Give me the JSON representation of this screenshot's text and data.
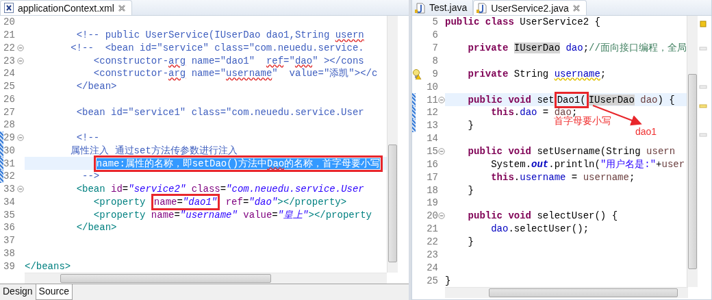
{
  "left_editor": {
    "tabs": [
      {
        "label": "applicationContext.xml",
        "selected": true,
        "closable": true
      }
    ],
    "lines": [
      {
        "number": "20",
        "fold": false,
        "current": false,
        "changed": false,
        "warning": false
      },
      {
        "number": "21",
        "fold": false,
        "current": false,
        "changed": false,
        "warning": false,
        "tokens": [
          {
            "text": "         <!-- public UserService(IUserDao dao1,String ",
            "kind": "c"
          },
          {
            "text": "usern",
            "kind": "cs"
          }
        ]
      },
      {
        "number": "22",
        "fold": true,
        "current": false,
        "changed": false,
        "warning": false,
        "tokens": [
          {
            "text": "        <!--  <bean id=\"service\" class=\"com.neuedu.service.",
            "kind": "c"
          }
        ]
      },
      {
        "number": "23",
        "fold": true,
        "current": false,
        "changed": false,
        "warning": false,
        "tokens": [
          {
            "text": "            <constructor-",
            "kind": "c"
          },
          {
            "text": "arg",
            "kind": "cs"
          },
          {
            "text": " name=\"dao1\"  ",
            "kind": "c"
          },
          {
            "text": "ref",
            "kind": "cs"
          },
          {
            "text": "=\"",
            "kind": "c"
          },
          {
            "text": "dao",
            "kind": "cs"
          },
          {
            "text": "\" ></cons",
            "kind": "c"
          }
        ]
      },
      {
        "number": "24",
        "fold": false,
        "current": false,
        "changed": false,
        "warning": false,
        "tokens": [
          {
            "text": "            <constructor-",
            "kind": "c"
          },
          {
            "text": "arg",
            "kind": "cs"
          },
          {
            "text": " name=\"",
            "kind": "c"
          },
          {
            "text": "username",
            "kind": "cs"
          },
          {
            "text": "\"  value=\"添凯\"></c",
            "kind": "c"
          }
        ]
      },
      {
        "number": "25",
        "fold": false,
        "current": false,
        "changed": false,
        "warning": false,
        "tokens": [
          {
            "text": "         </bean>",
            "kind": "c"
          }
        ]
      },
      {
        "number": "26",
        "fold": false,
        "current": false,
        "changed": false,
        "warning": false
      },
      {
        "number": "27",
        "fold": false,
        "current": false,
        "changed": false,
        "warning": false,
        "tokens": [
          {
            "text": "         <bean id=\"service1\" class=\"com.neuedu.service.User",
            "kind": "c"
          }
        ]
      },
      {
        "number": "28",
        "fold": false,
        "current": false,
        "changed": false,
        "warning": false
      },
      {
        "number": "29",
        "fold": true,
        "current": false,
        "changed": true,
        "warning": false,
        "tokens": [
          {
            "text": "         <!--",
            "kind": "c"
          }
        ]
      },
      {
        "number": "30",
        "fold": false,
        "current": false,
        "changed": true,
        "warning": false,
        "tokens": [
          {
            "text": "        属性注入 通过set方法传参数进行注入",
            "kind": "c"
          }
        ]
      },
      {
        "number": "31",
        "fold": false,
        "current": true,
        "changed": true,
        "warning": false,
        "tokens": [
          {
            "kind": "boxed",
            "tokens": [
              {
                "text": "            name:属性的名称，即setDao()方法中",
                "kind": "sel"
              },
              {
                "text": "Dao",
                "kind": "selspell"
              },
              {
                "text": "的名称，首字母要小写",
                "kind": "sel"
              }
            ]
          }
        ]
      },
      {
        "number": "32",
        "fold": false,
        "current": false,
        "changed": true,
        "warning": false,
        "tokens": [
          {
            "text": "          -->",
            "kind": "c"
          }
        ]
      },
      {
        "number": "33",
        "fold": true,
        "current": false,
        "changed": false,
        "warning": false,
        "tokens": [
          {
            "text": "         <bean ",
            "kind": "t"
          },
          {
            "text": "id",
            "kind": "a"
          },
          {
            "text": "=",
            "kind": "p"
          },
          {
            "text": "\"service2\"",
            "kind": "v"
          },
          {
            "text": " class",
            "kind": "a"
          },
          {
            "text": "=",
            "kind": "p"
          },
          {
            "text": "\"com.neuedu.service.User",
            "kind": "v"
          }
        ]
      },
      {
        "number": "34",
        "fold": false,
        "current": false,
        "changed": false,
        "warning": false,
        "tokens": [
          {
            "text": "            <property ",
            "kind": "t"
          },
          {
            "kind": "boxed",
            "tokens": [
              {
                "text": "name",
                "kind": "a"
              },
              {
                "text": "=",
                "kind": "p"
              },
              {
                "text": "\"dao1\"",
                "kind": "v"
              }
            ]
          },
          {
            "text": " ref",
            "kind": "a"
          },
          {
            "text": "=",
            "kind": "p"
          },
          {
            "text": "\"dao\"",
            "kind": "v"
          },
          {
            "text": "></property>",
            "kind": "t"
          }
        ]
      },
      {
        "number": "35",
        "fold": false,
        "current": false,
        "changed": false,
        "warning": false,
        "tokens": [
          {
            "text": "            <property ",
            "kind": "t"
          },
          {
            "text": "name",
            "kind": "a"
          },
          {
            "text": "=",
            "kind": "p"
          },
          {
            "text": "\"username\"",
            "kind": "v"
          },
          {
            "text": " value",
            "kind": "a"
          },
          {
            "text": "=",
            "kind": "p"
          },
          {
            "text": "\"皇上\"",
            "kind": "v"
          },
          {
            "text": "></property",
            "kind": "t"
          }
        ]
      },
      {
        "number": "36",
        "fold": false,
        "current": false,
        "changed": false,
        "warning": false,
        "tokens": [
          {
            "text": "         </bean>",
            "kind": "t"
          }
        ]
      },
      {
        "number": "37",
        "fold": false,
        "current": false,
        "changed": false,
        "warning": false
      },
      {
        "number": "38",
        "fold": false,
        "current": false,
        "changed": false,
        "warning": false
      },
      {
        "number": "39",
        "fold": false,
        "current": false,
        "changed": false,
        "warning": false,
        "tokens": [
          {
            "text": "</beans>",
            "kind": "t"
          }
        ]
      }
    ],
    "bottom_tabs": [
      {
        "label": "Design",
        "selected": false
      },
      {
        "label": "Source",
        "selected": true
      }
    ]
  },
  "right_editor": {
    "tabs": [
      {
        "label": "Test.java",
        "selected": false,
        "closable": false
      },
      {
        "label": "UserService2.java",
        "selected": true,
        "closable": true
      }
    ],
    "lines": [
      {
        "number": "5",
        "fold": false,
        "current": false,
        "changed": false,
        "warning": false,
        "tokens": [
          {
            "text": "public class",
            "kind": "k"
          },
          {
            "text": " UserService2 {",
            "kind": "p"
          }
        ]
      },
      {
        "number": "6",
        "fold": false,
        "current": false,
        "changed": false,
        "warning": false
      },
      {
        "number": "7",
        "fold": false,
        "current": false,
        "changed": false,
        "warning": false,
        "tokens": [
          {
            "text": "    private ",
            "kind": "k"
          },
          {
            "text": "IUserDao",
            "kind": "m"
          },
          {
            "text": " dao",
            "kind": "f"
          },
          {
            "text": ";",
            "kind": "p"
          },
          {
            "text": "//面向接口编程，全局",
            "kind": "jc"
          }
        ]
      },
      {
        "number": "8",
        "fold": false,
        "current": false,
        "changed": false,
        "warning": false
      },
      {
        "number": "9",
        "fold": false,
        "current": false,
        "changed": false,
        "warning": true,
        "tokens": [
          {
            "text": "    private ",
            "kind": "k"
          },
          {
            "text": "String ",
            "kind": "p"
          },
          {
            "text": "username",
            "kind": "fw"
          },
          {
            "text": ";",
            "kind": "p"
          }
        ]
      },
      {
        "number": "10",
        "fold": false,
        "current": false,
        "changed": false,
        "warning": false
      },
      {
        "number": "11",
        "fold": true,
        "current": true,
        "changed": true,
        "warning": false,
        "tokens": [
          {
            "text": "    public void ",
            "kind": "k"
          },
          {
            "text": "set",
            "kind": "p"
          },
          {
            "kind": "boxed",
            "tokens": [
              {
                "text": "Dao1(",
                "kind": "p"
              }
            ]
          },
          {
            "text": "IUserDao",
            "kind": "m"
          },
          {
            "text": " dao",
            "kind": "l"
          },
          {
            "text": ") {",
            "kind": "p"
          }
        ]
      },
      {
        "number": "12",
        "fold": false,
        "current": false,
        "changed": true,
        "warning": false,
        "tokens": [
          {
            "text": "        this",
            "kind": "k"
          },
          {
            "text": ".",
            "kind": "p"
          },
          {
            "text": "dao",
            "kind": "f"
          },
          {
            "text": " = ",
            "kind": "p"
          },
          {
            "text": "dao",
            "kind": "l"
          },
          {
            "text": ";",
            "kind": "p"
          }
        ]
      },
      {
        "number": "13",
        "fold": false,
        "current": false,
        "changed": true,
        "warning": false,
        "tokens": [
          {
            "text": "    }",
            "kind": "p"
          }
        ]
      },
      {
        "number": "14",
        "fold": false,
        "current": false,
        "changed": false,
        "warning": false
      },
      {
        "number": "15",
        "fold": true,
        "current": false,
        "changed": false,
        "warning": false,
        "tokens": [
          {
            "text": "    public void ",
            "kind": "k"
          },
          {
            "text": "setUsername(String ",
            "kind": "p"
          },
          {
            "text": "usern",
            "kind": "l"
          }
        ]
      },
      {
        "number": "16",
        "fold": false,
        "current": false,
        "changed": false,
        "warning": false,
        "tokens": [
          {
            "text": "        System.",
            "kind": "p"
          },
          {
            "text": "out",
            "kind": "fo"
          },
          {
            "text": ".println(",
            "kind": "p"
          },
          {
            "text": "\"用户名是:\"",
            "kind": "s"
          },
          {
            "text": "+",
            "kind": "p"
          },
          {
            "text": "user",
            "kind": "l"
          }
        ]
      },
      {
        "number": "17",
        "fold": false,
        "current": false,
        "changed": false,
        "warning": false,
        "tokens": [
          {
            "text": "        this",
            "kind": "k"
          },
          {
            "text": ".",
            "kind": "p"
          },
          {
            "text": "username",
            "kind": "f"
          },
          {
            "text": " = ",
            "kind": "p"
          },
          {
            "text": "username",
            "kind": "l"
          },
          {
            "text": ";",
            "kind": "p"
          }
        ]
      },
      {
        "number": "18",
        "fold": false,
        "current": false,
        "changed": false,
        "warning": false,
        "tokens": [
          {
            "text": "    }",
            "kind": "p"
          }
        ]
      },
      {
        "number": "19",
        "fold": false,
        "current": false,
        "changed": false,
        "warning": false
      },
      {
        "number": "20",
        "fold": true,
        "current": false,
        "changed": false,
        "warning": false,
        "tokens": [
          {
            "text": "    public void ",
            "kind": "k"
          },
          {
            "text": "selectUser() {",
            "kind": "p"
          }
        ]
      },
      {
        "number": "21",
        "fold": false,
        "current": false,
        "changed": false,
        "warning": false,
        "tokens": [
          {
            "text": "        dao",
            "kind": "f"
          },
          {
            "text": ".selectUser();",
            "kind": "p"
          }
        ]
      },
      {
        "number": "22",
        "fold": false,
        "current": false,
        "changed": false,
        "warning": false,
        "tokens": [
          {
            "text": "    }",
            "kind": "p"
          }
        ]
      },
      {
        "number": "23",
        "fold": false,
        "current": false,
        "changed": false,
        "warning": false
      },
      {
        "number": "24",
        "fold": false,
        "current": false,
        "changed": false,
        "warning": false
      },
      {
        "number": "25",
        "fold": false,
        "current": false,
        "changed": false,
        "warning": false,
        "tokens": [
          {
            "text": "}",
            "kind": "p"
          }
        ]
      }
    ]
  },
  "annotations": [
    {
      "text": "首字母要小写"
    },
    {
      "text": "dao1"
    }
  ]
}
